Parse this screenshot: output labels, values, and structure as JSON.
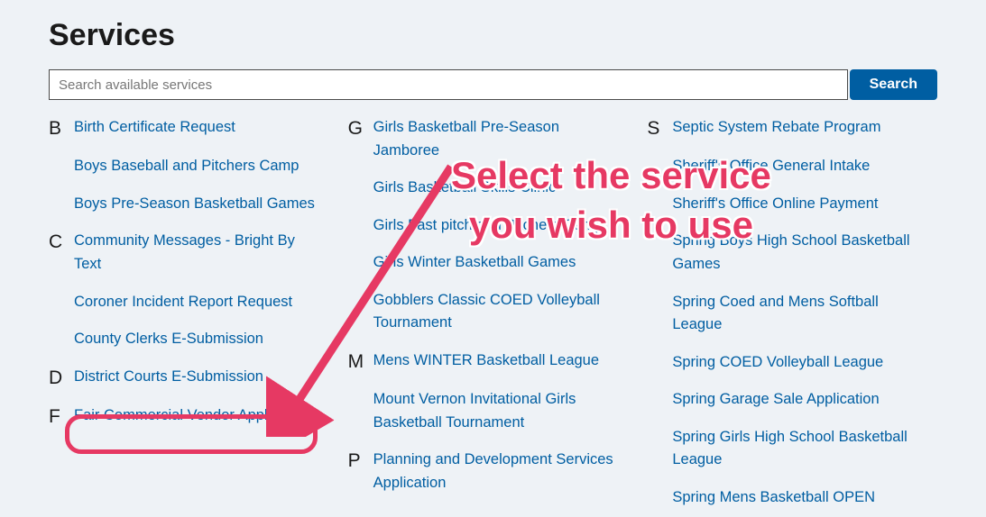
{
  "title": "Services",
  "search": {
    "placeholder": "Search available services",
    "button": "Search"
  },
  "annotation": {
    "line1": "Select the service",
    "line2": "you wish to use"
  },
  "columns": [
    [
      {
        "letter": "B",
        "label": "Birth Certificate Request"
      },
      {
        "letter": "",
        "label": "Boys Baseball and Pitchers Camp"
      },
      {
        "letter": "",
        "label": "Boys Pre-Season Basketball Games"
      },
      {
        "letter": "C",
        "label": "Community Messages - Bright By Text"
      },
      {
        "letter": "",
        "label": "Coroner Incident Report Request"
      },
      {
        "letter": "",
        "label": "County Clerks E-Submission"
      },
      {
        "letter": "D",
        "label": "District Courts E-Submission",
        "highlight": true
      },
      {
        "letter": "F",
        "label": "Fair Commercial Vendor Application"
      }
    ],
    [
      {
        "letter": "G",
        "label": "Girls Basketball Pre-Season Jamboree"
      },
      {
        "letter": "",
        "label": "Girls Basketball Skills Clinic"
      },
      {
        "letter": "",
        "label": "Girls Fast pitch and Pitchers Camp"
      },
      {
        "letter": "",
        "label": "Girls Winter Basketball Games"
      },
      {
        "letter": "",
        "label": "Gobblers Classic COED Volleyball Tournament"
      },
      {
        "letter": "M",
        "label": "Mens WINTER Basketball League"
      },
      {
        "letter": "",
        "label": "Mount Vernon Invitational Girls Basketball Tournament"
      },
      {
        "letter": "P",
        "label": "Planning and Development Services Application"
      }
    ],
    [
      {
        "letter": "S",
        "label": "Septic System Rebate Program"
      },
      {
        "letter": "",
        "label": "Sheriff's Office General Intake"
      },
      {
        "letter": "",
        "label": "Sheriff's Office Online Payment"
      },
      {
        "letter": "",
        "label": "Spring Boys High School Basketball Games"
      },
      {
        "letter": "",
        "label": "Spring Coed and Mens Softball League"
      },
      {
        "letter": "",
        "label": "Spring COED Volleyball League"
      },
      {
        "letter": "",
        "label": "Spring Garage Sale Application"
      },
      {
        "letter": "",
        "label": "Spring Girls High School Basketball League"
      },
      {
        "letter": "",
        "label": "Spring Mens Basketball OPEN"
      }
    ]
  ]
}
